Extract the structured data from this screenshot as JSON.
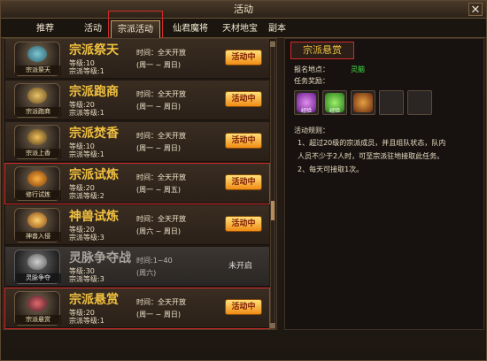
{
  "window": {
    "title": "活动"
  },
  "tabs": [
    {
      "label": "推荐"
    },
    {
      "label": "活动"
    },
    {
      "label": "宗派活动"
    },
    {
      "label": "仙君魔将"
    },
    {
      "label": "天材地宝"
    },
    {
      "label": "副本"
    }
  ],
  "activities": [
    {
      "icon_caption": "宗派祭天",
      "name": "宗派祭天",
      "level": "等级:10",
      "sect_level": "宗派等级:1",
      "time": "时间：全天开放",
      "days": "(周一 ~ 周日)",
      "status": "活动中"
    },
    {
      "icon_caption": "宗派跑商",
      "name": "宗派跑商",
      "level": "等级:20",
      "sect_level": "宗派等级:1",
      "time": "时间：全天开放",
      "days": "(周一 ~ 周日)",
      "status": "活动中"
    },
    {
      "icon_caption": "宗派上香",
      "name": "宗派焚香",
      "level": "等级:10",
      "sect_level": "宗派等级:1",
      "time": "时间：全天开放",
      "days": "(周一 ~ 周日)",
      "status": "活动中"
    },
    {
      "icon_caption": "修行试炼",
      "name": "宗派试炼",
      "level": "等级:20",
      "sect_level": "宗派等级:2",
      "time": "时间：全天开放",
      "days": "(周一 ~ 周五)",
      "status": "活动中"
    },
    {
      "icon_caption": "神兽入侵",
      "name": "神兽试炼",
      "level": "等级:20",
      "sect_level": "宗派等级:3",
      "time": "时间：全天开放",
      "days": "(周六 ~ 周日)",
      "status": "活动中"
    },
    {
      "icon_caption": "灵脉争夺",
      "name": "灵脉争夺战",
      "level": "等级:30",
      "sect_level": "宗派等级:3",
      "time": "时间:1~40",
      "days": "(周六)",
      "status": "未开启"
    },
    {
      "icon_caption": "宗派悬赏",
      "name": "宗派悬赏",
      "level": "等级:20",
      "sect_level": "宗派等级:1",
      "time": "时间：全天开放",
      "days": "(周一 ~ 周日)",
      "status": "活动中"
    }
  ],
  "detail": {
    "title": "宗派悬赏",
    "location_label": "报名地点：",
    "location_value": "灵脑",
    "rewards_label": "任务奖励：",
    "rewards": [
      {
        "icon": "purple-exp-orb",
        "caption": "经验"
      },
      {
        "icon": "green-exp-orb",
        "caption": "经验"
      },
      {
        "icon": "treasure-chest",
        "caption": ""
      },
      {
        "icon": "empty-slot",
        "caption": ""
      },
      {
        "icon": "empty-slot",
        "caption": ""
      }
    ],
    "rules_label": "活动规则：",
    "rules": [
      "1、超过20级的宗派成员，并且组队状态，队内",
      "人员不少于2人时，可至宗派驻地接取此任务。",
      "2、每天可接取1次。"
    ]
  }
}
